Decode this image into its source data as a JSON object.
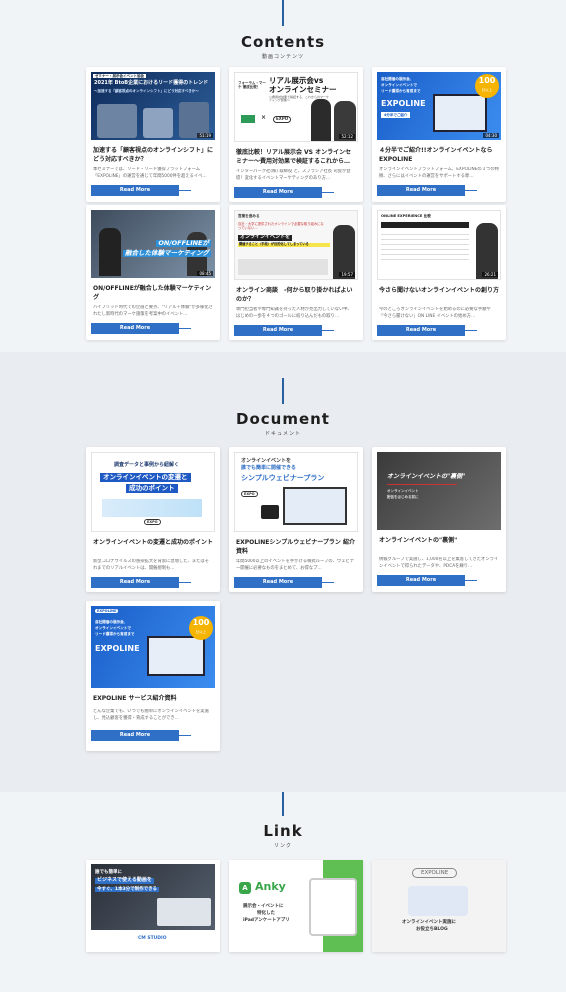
{
  "contents": {
    "title": "Contents",
    "subtitle": "動画コンテンツ",
    "cards": [
      {
        "title": "加速する「顧客視点のオンラインシフト」にどう対応すべきか？",
        "desc": "本セミナーでは、リード・リード獲得プラットフォーム「EXPOLINE」の運営を通じて年間5000件を超えるイベ…",
        "thumb_badge": "ゼミナー・展示会イベント協会",
        "thumb_line1": "2021年 BtoB企業におけるリード獲得のトレンド",
        "thumb_line2": "～加速する「顧客視点のオンラインシフト」にどう対応すべきか～",
        "duration": "51:19",
        "button": "Read More"
      },
      {
        "title": "徹底比較！リアル展示会 VS オンラインセミナー〜費用対効果で検証するこれから…",
        "desc": "インターパーク社(株) 取締役 と、スプラシア社長 司会が登壇！変化するイベントマーケティングのあり方…",
        "thumb_small": "フォーラム・マーケ 徹底比較！",
        "thumb_line1": "リアル展示会vs",
        "thumb_line2": "オンラインセミナー",
        "thumb_line3": "～費用対効果で検証する、これからのマーケティング施策～",
        "thumb_logo": "EXPO",
        "duration": "52:12",
        "button": "Read More"
      },
      {
        "title": "４分半でご紹介!!オンラインイベントならEXPOLINE",
        "desc": "オンラインイベントプラットフォーム、EXPOLINEの３つの特徴、さらにはイベントの運営をサポートする専…",
        "thumb_line1": "自社開催の展示会、",
        "thumb_line2": "オンラインイベントで",
        "thumb_line3": "リード獲得から育成まで",
        "thumb_brand": "EXPOLINE",
        "thumb_cta": "4分半でご紹介",
        "thumb_badge_num": "100",
        "thumb_badge_unit": "社以上",
        "duration": "04:30",
        "button": "Read More"
      },
      {
        "title": "ON/OFFLINEが融合した体験マーケティング",
        "desc": "ハイブリッド時代での企画と要点、\"リアル＋体験\"が多様化されたし新時代のマーケ施策を考案中のイベント…",
        "thumb_line1": "ON/OFFLINEが",
        "thumb_line2": "融合した体験マーケティング",
        "duration": "08:45",
        "button": "Read More"
      },
      {
        "title": "オンライン商談　-何から取り掛かればよいのか？",
        "desc": "専門担当者や専門知識を持った人材が見出力していない中、はじめの一歩を４つのゴールに絞り込んだもの取り…",
        "thumb_small": "営業を進める",
        "thumb_line1": "自社・大学に提供されたオンラインで必要な取り組みになっていない…",
        "thumb_line2": "オンラインイベントを",
        "thumb_line3": "開催すること（手段）が目的化してしまっている",
        "duration": "19:57",
        "button": "Read More"
      },
      {
        "title": "今さら聞けないオンラインイベントの創り方",
        "desc": "今のところオンラインイベントを始めるのに必要な手順や「今さら聞けない」ON LINE イベントの始め方…",
        "thumb_header": "ONLINE EXPERIENCE 比較",
        "duration": "26:21",
        "button": "Read More"
      }
    ]
  },
  "document": {
    "title": "Document",
    "subtitle": "ドキュメント",
    "cards": [
      {
        "title": "オンラインイベントの変遷と成功のポイント",
        "desc": "新型コロナウイルスの感染拡大を背景に急増した、またはそれまでのリアルイベントは、開催規制も…",
        "thumb_line0": "調査データと事例から紐解く",
        "thumb_line1": "オンラインイベントの変遷と",
        "thumb_line2": "成功のポイント",
        "thumb_logo": "EXPO",
        "button": "Read More"
      },
      {
        "title": "EXPOLINEシンプルウェビナープラン 紹介資料",
        "desc": "年間5000以上のイベントを手がける株式ループの、ウェビナー開催に必要なものをまとめて、お得なプ…",
        "thumb_line1": "オンラインイベントを",
        "thumb_line2": "誰でも簡単に開催できる",
        "thumb_line3": "シンプルウェビナープラン",
        "thumb_logo": "EXPO",
        "button": "Read More"
      },
      {
        "title": "オンラインイベントの\"裏側\"",
        "desc": "情報グループで実施し、1,000名以上を集客してきたオンラインイベントで得られたデータや、PDCAを繰り…",
        "thumb_line1": "オンラインイベントの\"裏側\"",
        "thumb_line2": "オンラインイベント",
        "thumb_line3": "配信をはじめる前に",
        "button": "Read More"
      },
      {
        "title": "EXPOLINE サービス紹介資料",
        "desc": "どんな企業でも、いつでも簡単にオンラインイベントを実施し、見込顧客を獲得・育成することができ…",
        "thumb_logo": "EXPOLINE",
        "thumb_line1": "自社開催の展示会、",
        "thumb_line2": "オンラインイベントで",
        "thumb_line3": "リード獲得から育成まで",
        "thumb_brand": "EXPOLINE",
        "thumb_badge_num": "100",
        "thumb_badge_unit": "社以上",
        "button": "Read More"
      }
    ]
  },
  "link": {
    "title": "Link",
    "subtitle": "リンク",
    "cards": [
      {
        "line1": "誰でも簡単に",
        "line2": "ビジネスで使える動画を",
        "line3": "今すぐ、1本3分で制作できる",
        "brand": "CM STUDIO"
      },
      {
        "brand": "Anky",
        "line1": "展示会・イベントに",
        "line2": "特化した",
        "line3": "iPadアンケートアプリ"
      },
      {
        "brand": "EXPOLINE",
        "line1": "オンラインイベント実施に",
        "line2": "お役立ちBLOG"
      }
    ]
  },
  "colors": {
    "accent": "#2f6fc6",
    "line": "#2a5fa0"
  }
}
